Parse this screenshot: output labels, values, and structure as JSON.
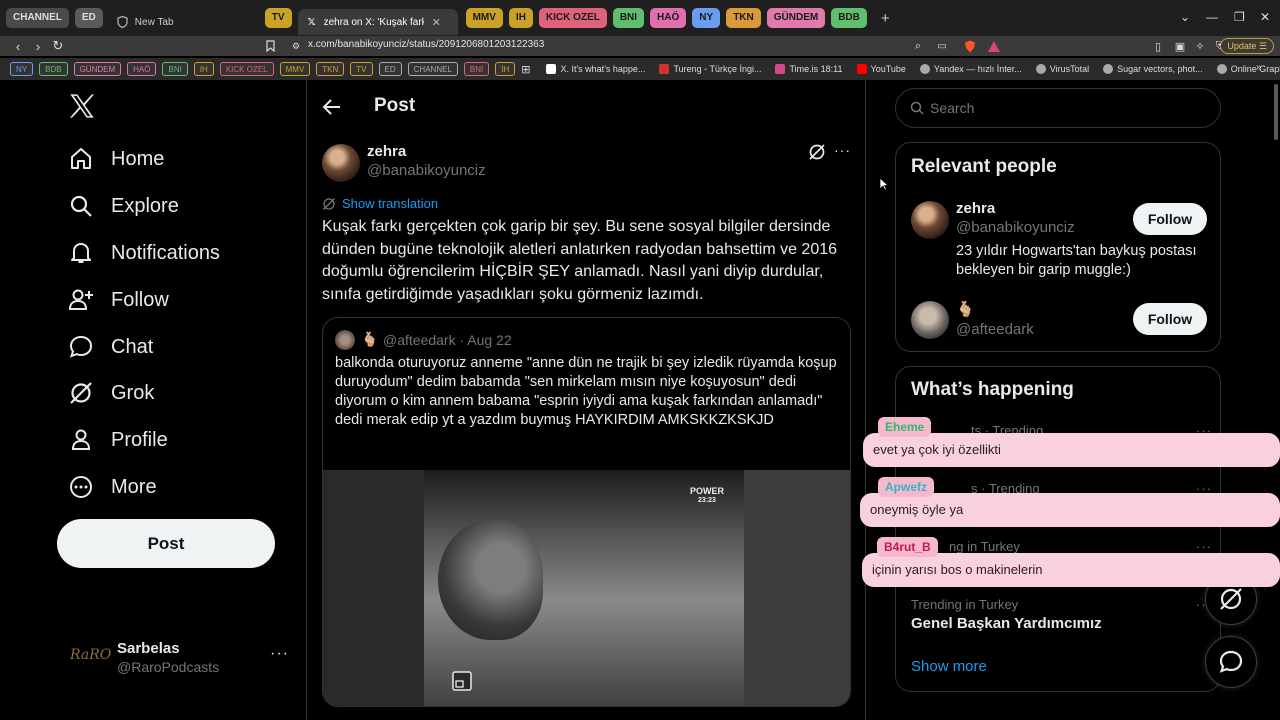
{
  "browser": {
    "tab_groups_left": [
      {
        "label": "CHANNEL",
        "color": "#4a4a4a",
        "text": "#dddddd"
      },
      {
        "label": "ED",
        "color": "#5a5a5a",
        "text": "#dddddd"
      }
    ],
    "tab_newtab": "New Tab",
    "tab_groups_mid1": [
      {
        "label": "TV",
        "color": "#c9a227",
        "text": "#1a1a1a"
      }
    ],
    "active_tab": "zehra on X: 'Kuşak farkı gerçekten",
    "tab_groups_mid2": [
      {
        "label": "MMV",
        "color": "#c9a227",
        "text": "#1a1a1a"
      },
      {
        "label": "IH",
        "color": "#c9a227",
        "text": "#1a1a1a"
      },
      {
        "label": "KICK OZEL",
        "color": "#e0627a",
        "text": "#1a1a1a"
      },
      {
        "label": "BNI",
        "color": "#5fbf6f",
        "text": "#1a1a1a"
      },
      {
        "label": "HAÖ",
        "color": "#e06fae",
        "text": "#1a1a1a"
      },
      {
        "label": "NY",
        "color": "#6a9cf0",
        "text": "#1a1a1a"
      },
      {
        "label": "TKN",
        "color": "#d99a3a",
        "text": "#1a1a1a"
      },
      {
        "label": "GÜNDEM",
        "color": "#e07aa8",
        "text": "#1a1a1a"
      },
      {
        "label": "BDB",
        "color": "#5fbf6f",
        "text": "#1a1a1a"
      }
    ],
    "new_tab_symbol": "+",
    "url": "x.com/banabikoyunciz/status/2091206801203122363",
    "update_label": "Update",
    "bookmark_chips": [
      {
        "label": "NY",
        "color": "#6a9cf0"
      },
      {
        "label": "BDB",
        "color": "#5fbf6f"
      },
      {
        "label": "GÜNDEM",
        "color": "#e07aa8"
      },
      {
        "label": "HAÖ",
        "color": "#e06fae"
      },
      {
        "label": "BNI",
        "color": "#5fbf6f"
      },
      {
        "label": "IH",
        "color": "#c9a227"
      },
      {
        "label": "KICK OZEL",
        "color": "#e0627a"
      },
      {
        "label": "MMV",
        "color": "#c9a227"
      },
      {
        "label": "TKN",
        "color": "#d99a3a"
      },
      {
        "label": "TV",
        "color": "#c9a227"
      },
      {
        "label": "ED",
        "color": "#aaaaaa"
      },
      {
        "label": "CHANNEL",
        "color": "#aaaaaa"
      },
      {
        "label": "BNİ",
        "color": "#e0627a"
      },
      {
        "label": "İH",
        "color": "#c9a227"
      }
    ],
    "bookmark_links": [
      {
        "label": "X. It's what's happe...",
        "icon": "x-icon",
        "color": "#ffffff"
      },
      {
        "label": "Tureng - Türkçe İngi...",
        "icon": "tureng-icon",
        "color": "#d0312d"
      },
      {
        "label": "Time.is 18:11",
        "icon": "clock-icon",
        "color": "#d14a8a"
      },
      {
        "label": "YouTube",
        "icon": "youtube-icon",
        "color": "#ff0000"
      },
      {
        "label": "Yandex — hızlı İnter...",
        "icon": "globe-icon",
        "color": "#aaaaaa"
      },
      {
        "label": "VirusTotal",
        "icon": "globe-icon",
        "color": "#aaaaaa"
      },
      {
        "label": "Sugar vectors, phot...",
        "icon": "globe-icon",
        "color": "#aaaaaa"
      },
      {
        "label": "Online Graphic Desi...",
        "icon": "globe-icon",
        "color": "#aaaaaa"
      }
    ]
  },
  "nav": {
    "items": [
      {
        "label": "Home",
        "icon": "home-icon"
      },
      {
        "label": "Explore",
        "icon": "search-icon"
      },
      {
        "label": "Notifications",
        "icon": "bell-icon"
      },
      {
        "label": "Follow",
        "icon": "person-add-icon"
      },
      {
        "label": "Chat",
        "icon": "chat-icon"
      },
      {
        "label": "Grok",
        "icon": "grok-icon"
      },
      {
        "label": "Profile",
        "icon": "person-icon"
      },
      {
        "label": "More",
        "icon": "more-circle-icon"
      }
    ],
    "post_button": "Post",
    "account": {
      "avatar_text": "RaRO",
      "name": "Sarbelas",
      "handle": "@RaroPodcasts",
      "more": "···"
    }
  },
  "main": {
    "title": "Post",
    "author": {
      "name": "zehra",
      "handle": "@banabikoyunciz"
    },
    "show_translation": "Show translation",
    "text": "Kuşak farkı gerçekten çok garip bir şey. Bu sene sosyal bilgiler dersinde dünden bugüne teknolojik aletleri anlatırken radyodan bahsettim ve 2016 doğumlu öğrencilerim HİÇBİR ŞEY anlamadı. Nasıl yani diyip durdular, sınıfa getirdiğimde yaşadıkları şoku görmeniz lazımdı.",
    "quote": {
      "emoji": "🫰🏼",
      "meta": "@afteedark · Aug 22",
      "text": "balkonda oturuyoruz anneme \"anne dün ne trajik bi şey izledik rüyamda koşup duruyodum\" dedim babamda \"sen mirkelam mısın niye koşuyosun\" dedi diyorum o kim annem babama \"esprin iyiydi ama kuşak farkından anlamadı\" dedi merak edip yt a yazdım buymuş HAYKIRDIM AMKSKKZKSKJD",
      "video_watermark_line1": "POWER",
      "video_watermark_line2": "23:23"
    }
  },
  "right": {
    "search_placeholder": "Search",
    "relevant_title": "Relevant people",
    "people": [
      {
        "name": "zehra",
        "handle": "@banabikoyunciz",
        "bio": "23 yıldır Hogwarts'tan baykuş postası bekleyen bir garip muggle:)",
        "follow": "Follow"
      },
      {
        "name": "🫰🏼",
        "handle": "@afteedark",
        "bio": "",
        "follow": "Follow"
      }
    ],
    "happening_title": "What’s happening",
    "trends": [
      {
        "meta": "ts · Trending",
        "title": ""
      },
      {
        "meta": "s · Trending",
        "title": ""
      },
      {
        "meta": "ng in Turkey",
        "title": ""
      },
      {
        "meta": "Trending in Turkey",
        "title": "Genel Başkan Yardımcımız"
      }
    ],
    "trend_more": "···",
    "show_more": "Show more"
  },
  "chat_overlay": [
    {
      "user": "Eheme",
      "user_color": "#2fb86a",
      "text": "evet ya çok iyi özellikti"
    },
    {
      "user": "Apwefz",
      "user_color": "#35b3c4",
      "text": "oneymiş öyle ya"
    },
    {
      "user": "B4rut_B",
      "user_color": "#c2185b",
      "text": "içinin yarısı bos o makinelerin"
    }
  ]
}
